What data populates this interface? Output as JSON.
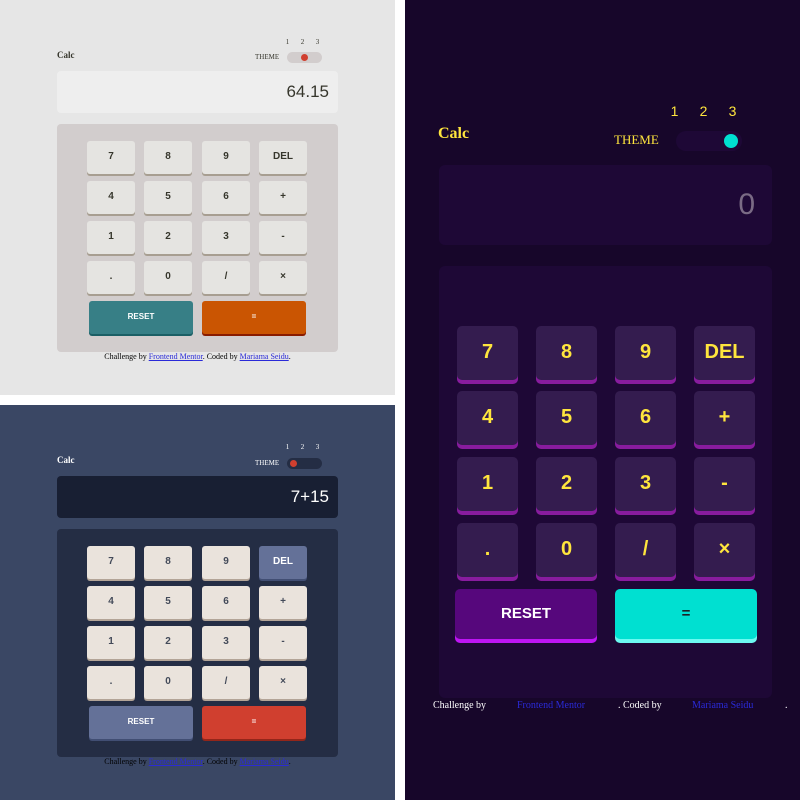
{
  "app": {
    "title": "Calc",
    "theme_label": "THEME",
    "theme_numbers": [
      "1",
      "2",
      "3"
    ]
  },
  "keys": {
    "k7": "7",
    "k8": "8",
    "k9": "9",
    "del": "DEL",
    "k4": "4",
    "k5": "5",
    "k6": "6",
    "plus": "+",
    "k1": "1",
    "k2": "2",
    "k3": "3",
    "minus": "-",
    "dot": ".",
    "k0": "0",
    "div": "/",
    "mul": "×",
    "reset": "RESET",
    "equals": "="
  },
  "credit": {
    "prefix": "Challenge by",
    "link1": "Frontend Mentor",
    "middle": ". Coded by",
    "link2": "Mariama Seidu",
    "suffix": "."
  },
  "screens": {
    "light": {
      "display": "64.15",
      "active_theme": 2
    },
    "navy": {
      "display": "7+15",
      "active_theme": 1
    },
    "violet": {
      "display": "0",
      "active_theme": 3
    }
  },
  "colors": {
    "light_bg": "#e6e6e6",
    "navy_bg": "#3a4764",
    "violet_bg": "#17062a",
    "light_toggle_knob": "#d03f2f",
    "navy_toggle_knob": "#d03f2f",
    "violet_toggle_knob": "#00e0d1",
    "light_reset": "#377f86",
    "light_equals": "#ca5502",
    "navy_reset": "#647198",
    "navy_equals": "#d03f2f",
    "violet_reset": "#56077c",
    "violet_equals": "#00e0d1",
    "violet_text": "#ffe53d"
  }
}
